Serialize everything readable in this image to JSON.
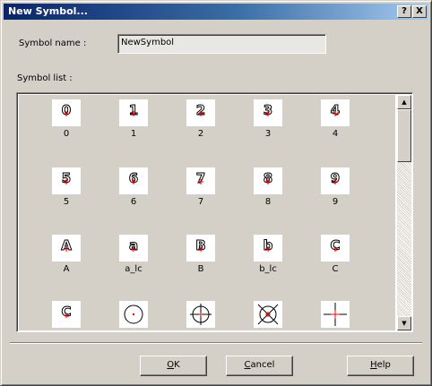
{
  "window": {
    "title": "New Symbol...",
    "help_button": "?",
    "close_button": "X"
  },
  "form": {
    "name_label": "Symbol name :",
    "name_value": "NewSymbol",
    "list_label": "Symbol list :"
  },
  "symbols": [
    {
      "glyph": "0",
      "label": "0"
    },
    {
      "glyph": "1",
      "label": "1"
    },
    {
      "glyph": "2",
      "label": "2"
    },
    {
      "glyph": "3",
      "label": "3"
    },
    {
      "glyph": "4",
      "label": "4"
    },
    {
      "glyph": "5",
      "label": "5"
    },
    {
      "glyph": "6",
      "label": "6"
    },
    {
      "glyph": "7",
      "label": "7"
    },
    {
      "glyph": "8",
      "label": "8"
    },
    {
      "glyph": "9",
      "label": "9"
    },
    {
      "glyph": "A",
      "label": "A"
    },
    {
      "glyph": "a",
      "label": "a_lc"
    },
    {
      "glyph": "B",
      "label": "B"
    },
    {
      "glyph": "b",
      "label": "b_lc"
    },
    {
      "glyph": "C",
      "label": "C"
    },
    {
      "glyph": "C",
      "label": ""
    },
    {
      "glyph": "circle-dot-icon",
      "label": ""
    },
    {
      "glyph": "crosshair-circle-icon",
      "label": ""
    },
    {
      "glyph": "circle-x-icon",
      "label": ""
    },
    {
      "glyph": "plus-cross-icon",
      "label": ""
    }
  ],
  "buttons": {
    "ok_mnemonic": "O",
    "ok_rest": "K",
    "cancel_mnemonic": "C",
    "cancel_rest": "ancel",
    "help_mnemonic": "H",
    "help_rest": "elp"
  },
  "colors": {
    "marker_red": "#ff0000",
    "title_gradient_start": "#0a246a",
    "title_gradient_end": "#a6caf0",
    "face": "#d4d0c8"
  }
}
